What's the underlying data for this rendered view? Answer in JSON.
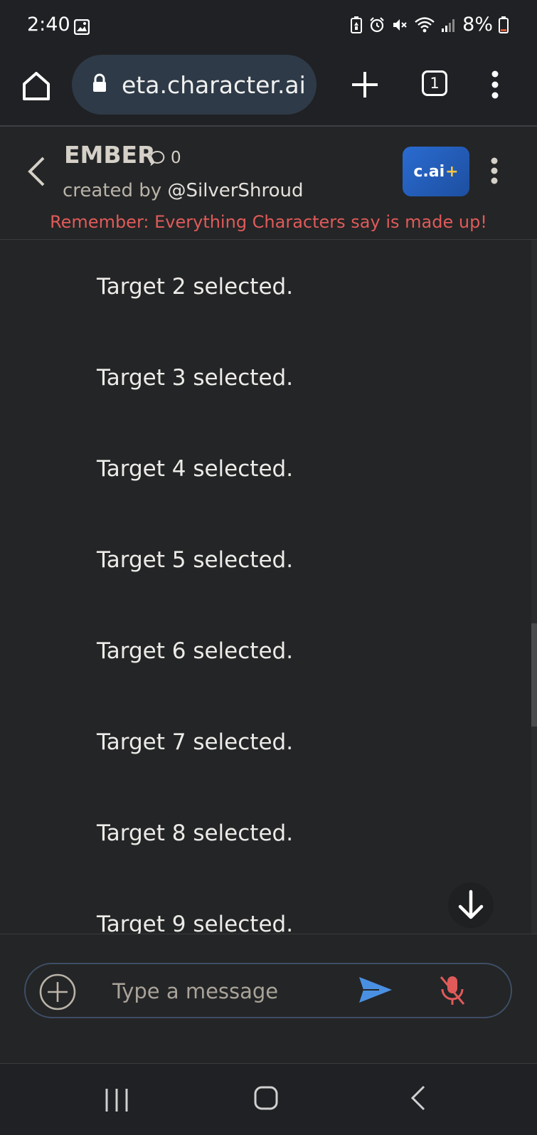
{
  "status_bar": {
    "time": "2:40",
    "battery": "8%"
  },
  "browser": {
    "url": "eta.character.ai",
    "tab_count": "1"
  },
  "chat_header": {
    "character_name": "EMBER",
    "chat_count": "0",
    "created_by_prefix": "created by",
    "creator_handle": "@SilverShroud",
    "plus_badge_text": "c.ai",
    "plus_badge_plus": "+",
    "disclaimer": "Remember: Everything Characters say is made up!"
  },
  "messages": [
    {
      "text": "Target 2 selected."
    },
    {
      "text": "Target 3 selected."
    },
    {
      "text": "Target 4 selected."
    },
    {
      "text": "Target 5 selected."
    },
    {
      "text": "Target 6 selected."
    },
    {
      "text": "Target 7 selected."
    },
    {
      "text": "Target 8 selected."
    },
    {
      "text": "Target 9 selected."
    }
  ],
  "input": {
    "placeholder": "Type a message"
  },
  "colors": {
    "background": "#242526",
    "disclaimer": "#e05a5a",
    "send_icon": "#4a90e2",
    "mic_icon": "#e05a5a",
    "plus_badge": "#2a6bd0"
  }
}
